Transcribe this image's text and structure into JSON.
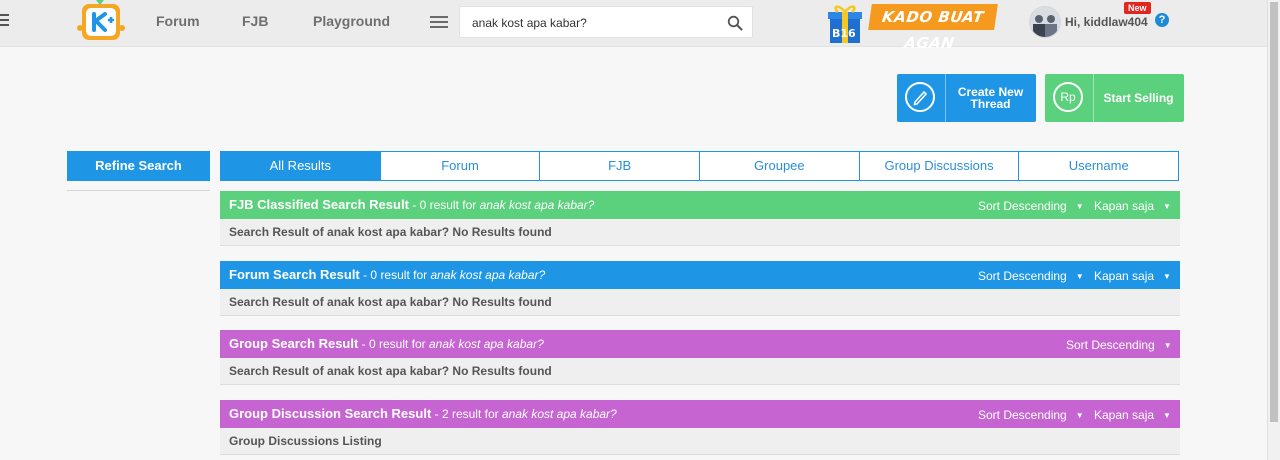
{
  "header": {
    "nav": [
      "Forum",
      "FJB",
      "Playground"
    ],
    "search": {
      "value": "anak kost apa kabar?"
    },
    "promo": "KADO BUAT AGAN",
    "user": {
      "greeting": "Hi, kiddlaw404",
      "badge": "New"
    },
    "help": "?"
  },
  "actions": {
    "create_thread": "Create New Thread",
    "start_selling": "Start Selling",
    "rp_symbol": "Rp"
  },
  "sidebar": {
    "refine": "Refine Search"
  },
  "tabs": [
    "All Results",
    "Forum",
    "FJB",
    "Groupee",
    "Group Discussions",
    "Username"
  ],
  "active_tab": "All Results",
  "sections": [
    {
      "title": "FJB Classified Search Result",
      "count_text": " - 0 result for ",
      "query": "anak kost apa kabar?",
      "sort": "Sort Descending",
      "time": "Kapan saja",
      "body": "Search Result of anak kost apa kabar? No Results found",
      "color": "#5bd07d"
    },
    {
      "title": "Forum Search Result",
      "count_text": " - 0 result for ",
      "query": "anak kost apa kabar?",
      "sort": "Sort Descending",
      "time": "Kapan saja",
      "body": "Search Result of anak kost apa kabar? No Results found",
      "color": "#1e96e5"
    },
    {
      "title": "Group Search Result",
      "count_text": " - 0 result for ",
      "query": "anak kost apa kabar?",
      "sort": "Sort Descending",
      "time": "",
      "body": "Search Result of anak kost apa kabar? No Results found",
      "color": "#c665d1"
    },
    {
      "title": "Group Discussion Search Result",
      "count_text": " - 2 result for ",
      "query": "anak kost apa kabar?",
      "sort": "Sort Descending",
      "time": "Kapan saja",
      "body": "Group Discussions Listing",
      "color": "#c665d1"
    }
  ],
  "colors": {
    "accent": "#1e96e5",
    "green": "#5bd07d",
    "purple": "#c665d1",
    "orange": "#f59a1e"
  }
}
